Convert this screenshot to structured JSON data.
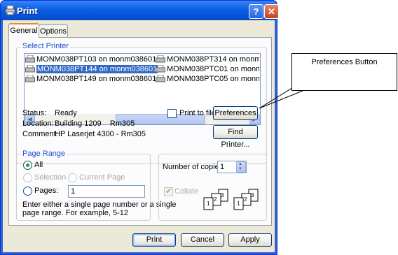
{
  "window": {
    "title": "Print",
    "help_glyph": "?",
    "close_glyph": "✕"
  },
  "tabs": [
    {
      "label": "General"
    },
    {
      "label": "Options"
    }
  ],
  "select_printer": {
    "group_label": "Select Printer",
    "printers": [
      {
        "name": "MONM038PT103 on monm038601"
      },
      {
        "name": "MONM038PT314 on monm03860"
      },
      {
        "name": "MONM038PT144 on monm038601",
        "selected": true
      },
      {
        "name": "MONM038PTC01 on monm03860"
      },
      {
        "name": "MONM038PT149 on monm038601"
      },
      {
        "name": "MONM038PTC05 on monm03860"
      }
    ],
    "status_label": "Status:",
    "status_value": "Ready",
    "location_label": "Location:",
    "location_value": "Building 1209    Rm305",
    "comment_label": "Comment:",
    "comment_value": "HP Laserjet 4300 - Rm305",
    "print_to_file_label": "Print to file",
    "preferences_label": "Preferences",
    "find_printer_label": "Find Printer..."
  },
  "page_range": {
    "group_label": "Page Range",
    "all_label": "All",
    "selection_label": "Selection",
    "current_page_label": "Current Page",
    "pages_label": "Pages:",
    "pages_value": "1",
    "hint_line1": "Enter either a single page number or a single",
    "hint_line2": "page range.  For example, 5-12"
  },
  "copies": {
    "number_label": "Number of copies:",
    "number_value": "1",
    "collate_label": "Collate"
  },
  "footer": {
    "print_label": "Print",
    "cancel_label": "Cancel",
    "apply_label": "Apply"
  },
  "callout": {
    "text": "Preferences Button"
  },
  "colors": {
    "titlebar": "#0a5ee0",
    "dialog_bg": "#ece9d8",
    "group_label": "#1c4fc9",
    "selection": "#316ac5"
  },
  "icons": [
    "printer-icon",
    "help-icon",
    "close-icon",
    "scroll-left-icon",
    "scroll-right-icon",
    "spin-up-icon",
    "spin-down-icon",
    "collate-pages-icon"
  ]
}
